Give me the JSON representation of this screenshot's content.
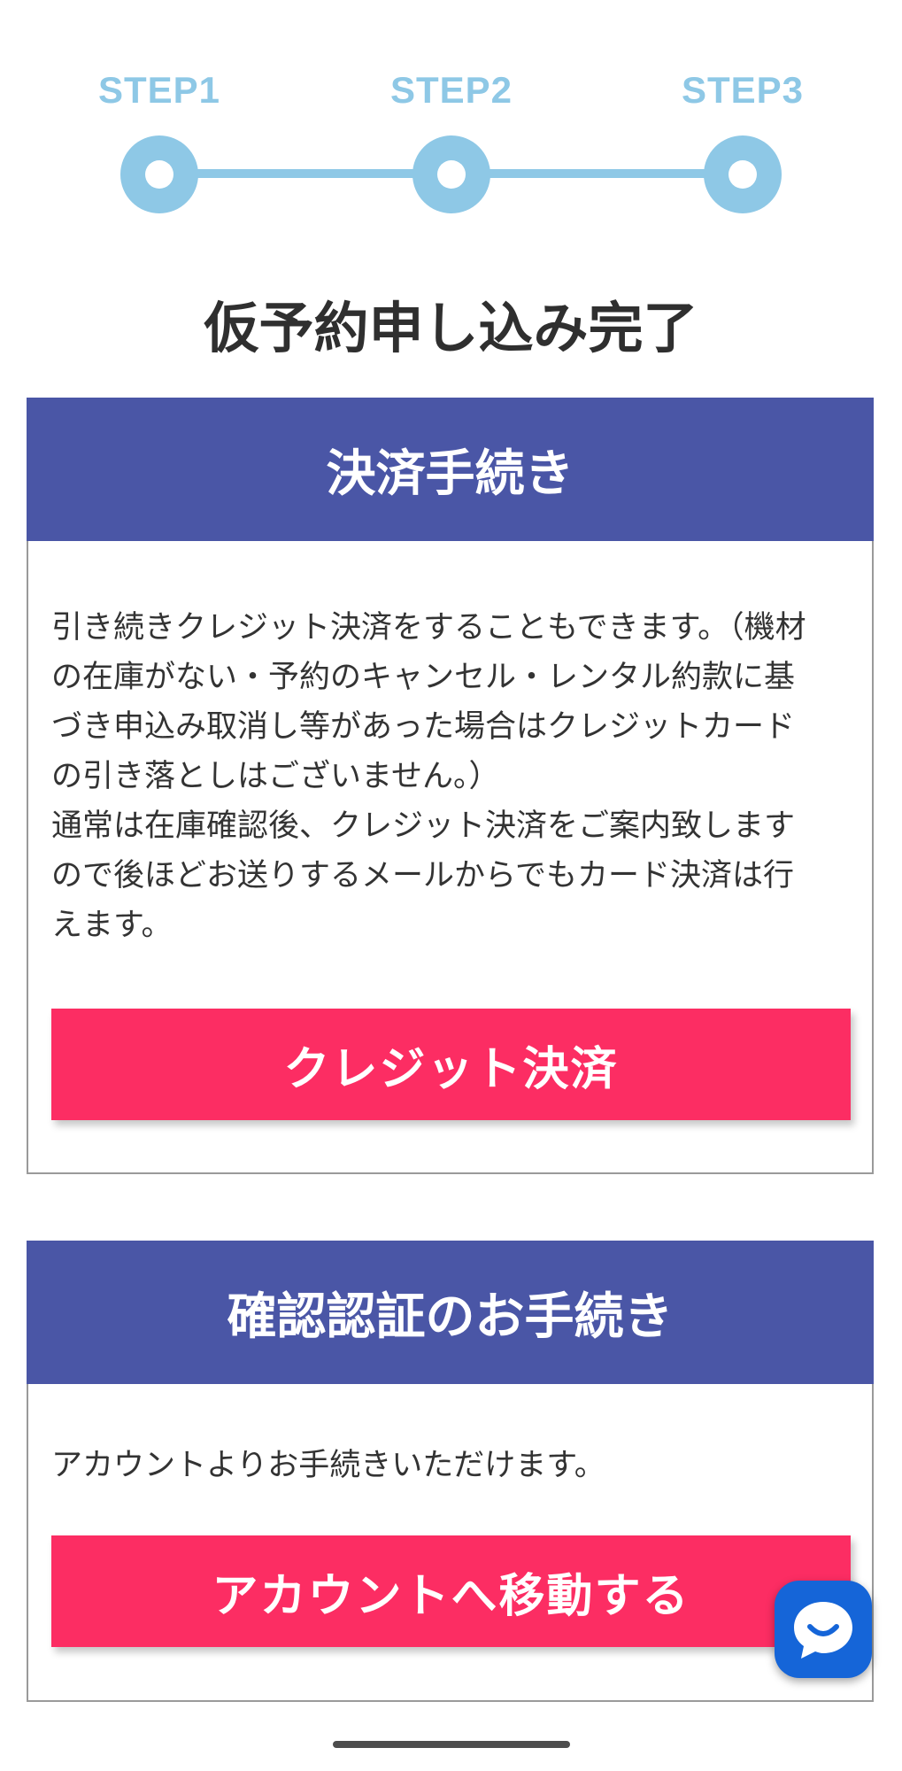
{
  "stepper": {
    "steps": [
      {
        "label": "STEP1"
      },
      {
        "label": "STEP2"
      },
      {
        "label": "STEP3"
      }
    ],
    "color": "#8ec8e6"
  },
  "page": {
    "title": "仮予約申し込み完了"
  },
  "payment_card": {
    "header": "決済手続き",
    "body_lines": [
      "引き続きクレジット決済をすることもできます。（機材",
      "の在庫がない・予約のキャンセル・レンタル約款に基",
      "づき申込み取消し等があった場合はクレジットカード",
      "の引き落としはございません。）",
      "通常は在庫確認後、クレジット決済をご案内致します",
      "ので後ほどお送りするメールからでもカード決済は行",
      "えます。"
    ],
    "button_label": "クレジット決済"
  },
  "verify_card": {
    "header": "確認認証のお手続き",
    "body": "アカウントよりお手続きいただけます。",
    "button_label": "アカウントへ移動する"
  },
  "chat": {
    "icon": "chat-bubble-icon",
    "color": "#1565d8"
  },
  "colors": {
    "header_bg": "#4a56a6",
    "button_bg": "#fc2d63",
    "step_accent": "#8ec8e6"
  }
}
